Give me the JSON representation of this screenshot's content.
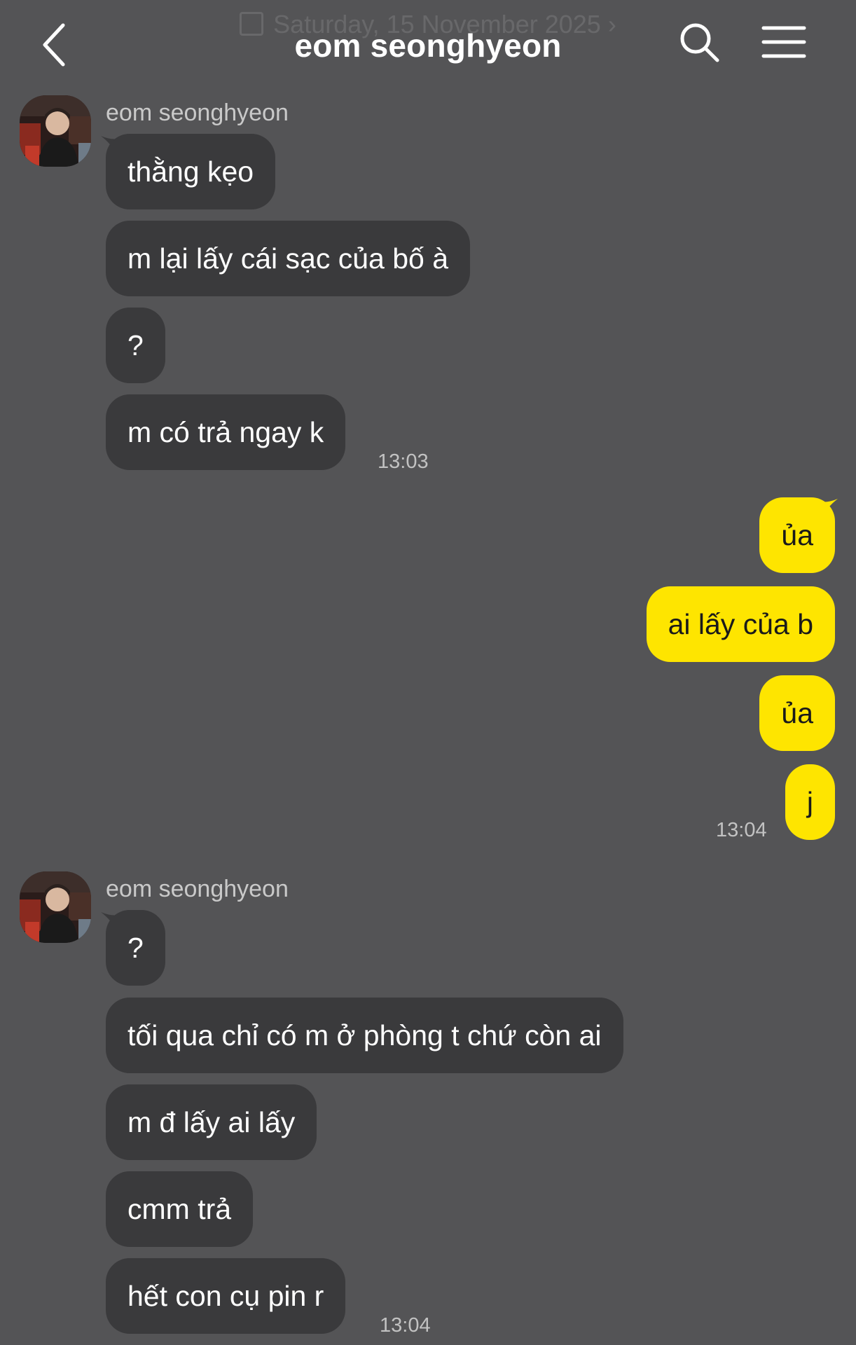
{
  "header": {
    "title": "eom seonghyeon",
    "date_label": "Saturday, 15 November 2025",
    "chevron": "›"
  },
  "icons": {
    "back": "chevron-left-icon",
    "search": "search-icon",
    "menu": "hamburger-menu-icon",
    "calendar": "calendar-icon"
  },
  "colors": {
    "background": "#545456",
    "incoming_bubble": "#3a3a3c",
    "outgoing_bubble": "#fee500"
  },
  "groups": [
    {
      "sender": "eom seonghyeon",
      "messages": [
        "thằng kẹo",
        "m lại lấy cái sạc của bố à",
        "?",
        "m có trả ngay k"
      ],
      "time": "13:03"
    },
    {
      "sender": "me",
      "messages": [
        "ủa",
        "ai lấy của b",
        "ủa",
        "j"
      ],
      "time": "13:04"
    },
    {
      "sender": "eom seonghyeon",
      "messages": [
        "?",
        "tối qua chỉ có m ở phòng t chứ còn ai",
        "m đ lấy ai lấy",
        "cmm trả",
        "hết con cụ pin r"
      ],
      "time": "13:04"
    }
  ]
}
